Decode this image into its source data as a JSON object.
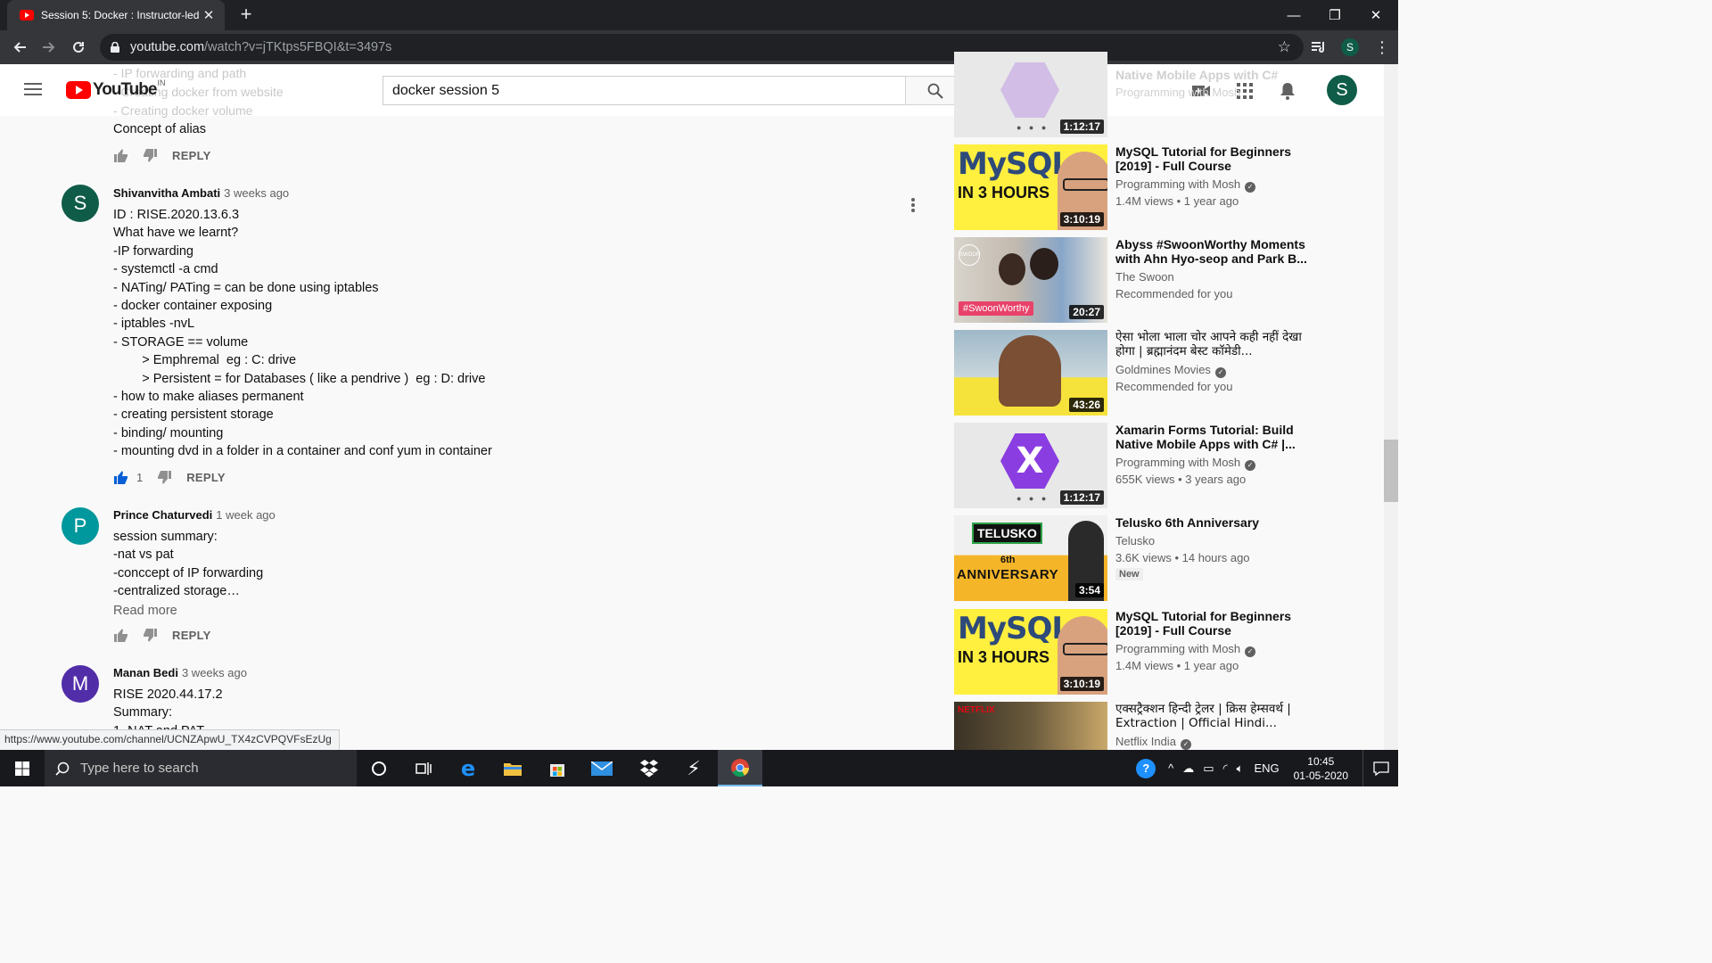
{
  "browser": {
    "tab_title": "Session 5: Docker : Instructor-led",
    "url_host": "youtube.com",
    "url_path": "/watch?v=jTKtps5FBQI&t=3497s",
    "profile_initial": "S"
  },
  "masthead": {
    "logo_text": "YouTube",
    "logo_country": "IN",
    "search_value": "docker session 5",
    "avatar_initial": "S"
  },
  "faded_top_lines": [
    "- IP forwarding and path",
    "- Creating docker from website",
    "- Creating docker volume"
  ],
  "comments": [
    {
      "text_lines": [
        "Concept of alias"
      ],
      "reply_label": "REPLY"
    },
    {
      "avatar_initial": "S",
      "avatar_color": "#0f5c48",
      "author": "Shivanvitha Ambati",
      "time": "3 weeks ago",
      "text_lines": [
        "ID : RISE.2020.13.6.3",
        "What have we learnt?",
        "-IP forwarding",
        "- systemctl -a cmd",
        "- NATing/ PATing = can be done using iptables",
        "- docker container exposing",
        "- iptables -nvL",
        "- STORAGE == volume",
        "        > Emphremal  eg : C: drive",
        "        > Persistent = for Databases ( like a pendrive )  eg : D: drive",
        "- how to make aliases permanent",
        "- creating persistent storage",
        "- binding/ mounting",
        "- mounting dvd in a folder in a container and conf yum in container"
      ],
      "likes": "1",
      "reply_label": "REPLY"
    },
    {
      "avatar_initial": "P",
      "avatar_color": "#00979d",
      "author": "Prince Chaturvedi",
      "time": "1 week ago",
      "text_lines": [
        "session summary:",
        "-nat vs pat",
        "-conccept of IP forwarding",
        "-centralized storage…"
      ],
      "read_more": "Read more",
      "reply_label": "REPLY"
    },
    {
      "avatar_initial": "M",
      "avatar_color": "#512da8",
      "author": "Manan Bedi",
      "time": "3 weeks ago",
      "text_lines": [
        "RISE 2020.44.17.2",
        "Summary:",
        "1. NAT and PAT"
      ]
    }
  ],
  "recommendations": [
    {
      "duration": "1:12:17",
      "faded_title": "Native Mobile Apps with C#",
      "faded_channel": "Programming with Mosh"
    },
    {
      "title": "MySQL Tutorial for Beginners [2019] - Full Course",
      "channel": "Programming with Mosh",
      "verified": true,
      "meta": "1.4M views • 1 year ago",
      "duration": "3:10:19",
      "thumb_line1": "MySQL",
      "thumb_line2": "IN 3 HOURS"
    },
    {
      "title": "Abyss #SwoonWorthy Moments with Ahn Hyo-seop and Park B...",
      "channel": "The Swoon",
      "verified": false,
      "meta": "Recommended for you",
      "duration": "20:27",
      "thumb_tag": "#SwoonWorthy"
    },
    {
      "title": "ऐसा भोला भाला चोर आपने कही नहीं देखा होगा | ब्रह्मानंदम बेस्ट कॉमेडी...",
      "channel": "Goldmines Movies",
      "verified": true,
      "meta": "Recommended for you",
      "duration": "43:26"
    },
    {
      "title": "Xamarin Forms Tutorial: Build Native Mobile Apps with C# |...",
      "channel": "Programming with Mosh",
      "verified": true,
      "meta": "655K views • 3 years ago",
      "duration": "1:12:17",
      "thumb_letter": "X"
    },
    {
      "title": "Telusko 6th Anniversary",
      "channel": "Telusko",
      "verified": false,
      "meta": "3.6K views • 14 hours ago",
      "badge": "New",
      "duration": "3:54",
      "thumb_line1": "TELUSKO",
      "thumb_line2": "6th",
      "thumb_line3": "ANNIVERSARY"
    },
    {
      "title": "MySQL Tutorial for Beginners [2019] - Full Course",
      "channel": "Programming with Mosh",
      "verified": true,
      "meta": "1.4M views • 1 year ago",
      "duration": "3:10:19",
      "thumb_line1": "MySQL",
      "thumb_line2": "IN 3 HOURS"
    },
    {
      "title": "एक्सट्रैक्शन हिन्दी ट्रेलर | क्रिस हेम्सवर्थ | Extraction | Official Hindi...",
      "channel": "Netflix India",
      "verified": true,
      "thumb_tag": "NETFLIX"
    }
  ],
  "status_url": "https://www.youtube.com/channel/UCNZApwU_TX4zCVPQVFsEzUg",
  "taskbar": {
    "search_placeholder": "Type here to search",
    "language": "ENG",
    "time": "10:45",
    "date": "01-05-2020"
  },
  "colors": {
    "youtube_red": "#ff0000",
    "chrome_dark": "#202124",
    "taskbar": "#18191d"
  }
}
